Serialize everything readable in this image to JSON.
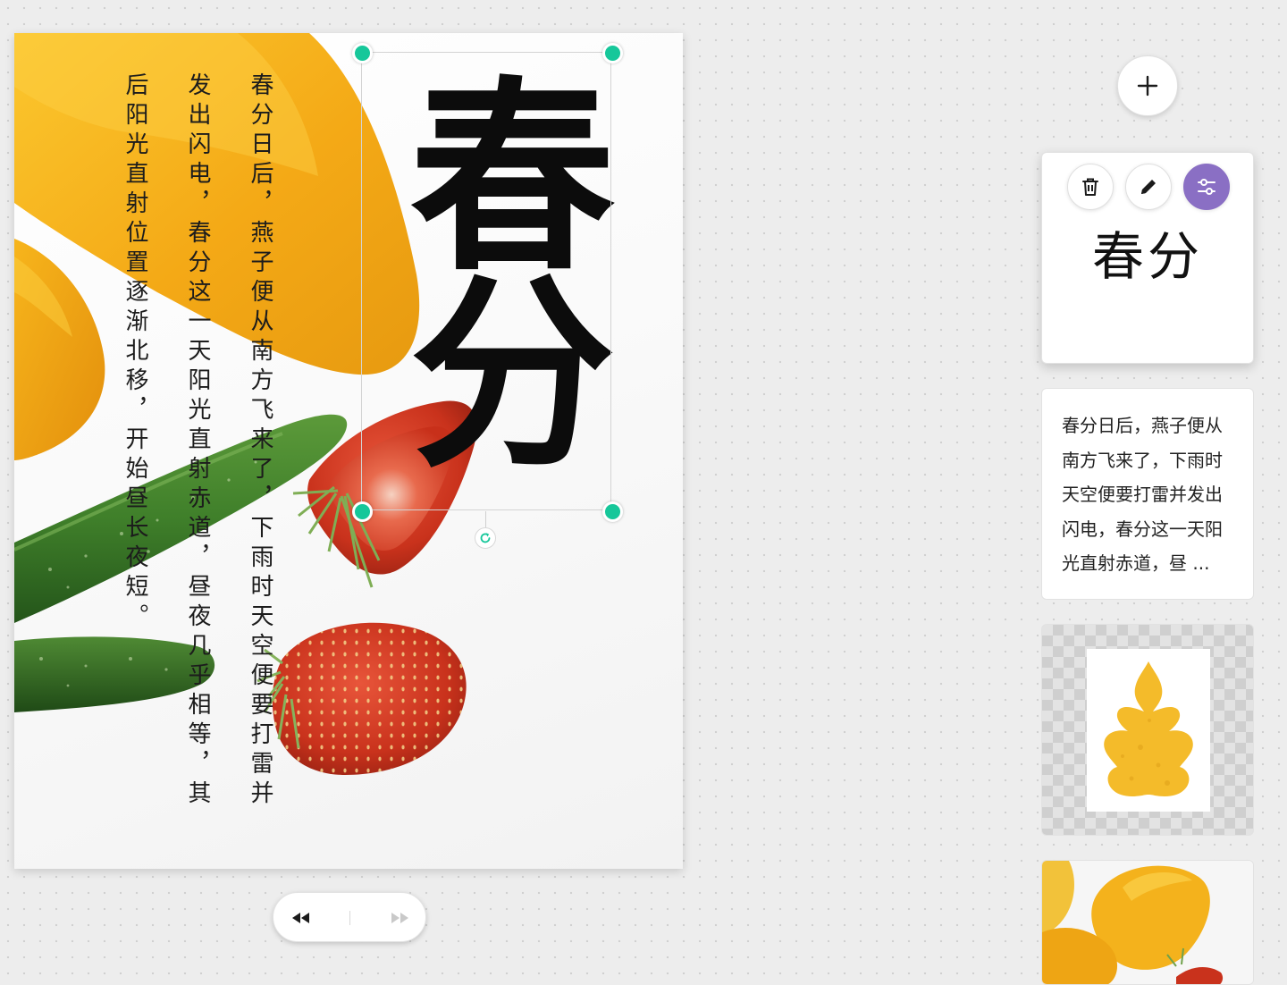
{
  "poster": {
    "title": "春分",
    "columns": [
      "春分日后，燕子便从南方飞来了，下雨时天空便要打雷并",
      "发出闪电，春分这一天阳光直射赤道，昼夜几乎相等，其",
      "后阳光直射位置逐渐北移，开始昼长夜短。"
    ]
  },
  "selection": {
    "handle_color": "#16c79a"
  },
  "pager": {
    "prev_icon": "rewind-icon",
    "next_icon": "fast-forward-icon"
  },
  "panel": {
    "add_icon": "plus-icon",
    "title_card": {
      "text": "春分",
      "tools": [
        "trash-icon",
        "pencil-icon",
        "sliders-icon"
      ],
      "active_tool_color": "#8a6fc4"
    },
    "body_card": {
      "text": "春分日后，燕子便从南方飞来了，下雨时天空便要打雷并发出闪电，春分这一天阳光直射赤道，昼 ..."
    },
    "shape_card": {
      "shape_color": "#f4bb2a"
    }
  },
  "colors": {
    "canvas_bg": "#ededed",
    "accent": "#16c79a",
    "mango": "#f5b520",
    "strawberry": "#d23a22",
    "cucumber": "#3a7d2a"
  }
}
